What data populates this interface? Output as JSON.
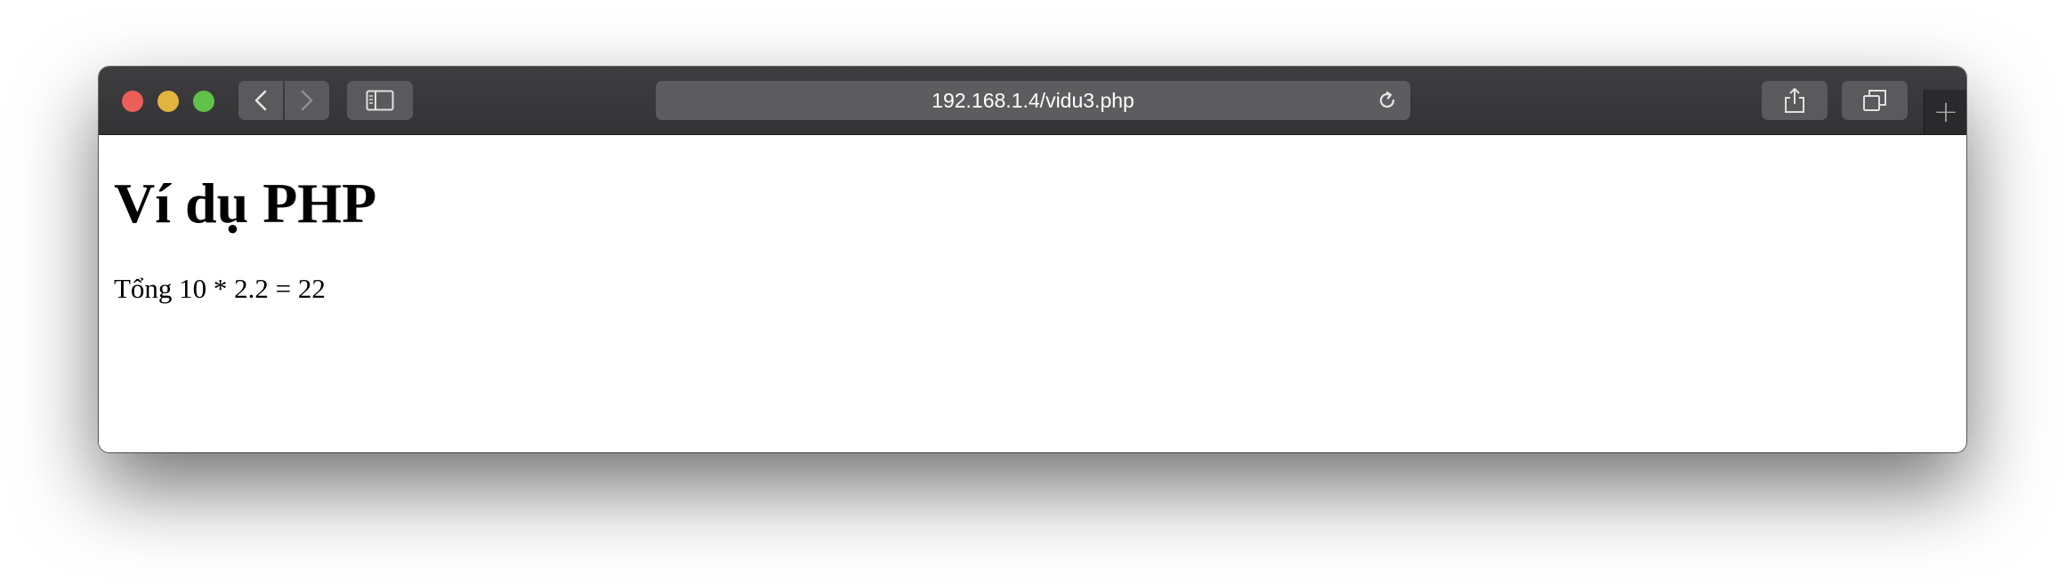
{
  "browser": {
    "address_bar": {
      "url": "192.168.1.4/vidu3.php"
    },
    "icons": {
      "back": "chevron-left-icon",
      "forward": "chevron-right-icon",
      "sidebar": "sidebar-icon",
      "reload": "reload-icon",
      "share": "share-icon",
      "tabs": "tabs-overview-icon",
      "new_tab": "plus-icon"
    },
    "colors": {
      "close": "#ec5f59",
      "minimize": "#e2b43d",
      "maximize": "#5fc24a",
      "toolbar": "#38383a"
    }
  },
  "page": {
    "heading": "Ví dụ PHP",
    "text": "Tổng 10 * 2.2 = 22"
  }
}
